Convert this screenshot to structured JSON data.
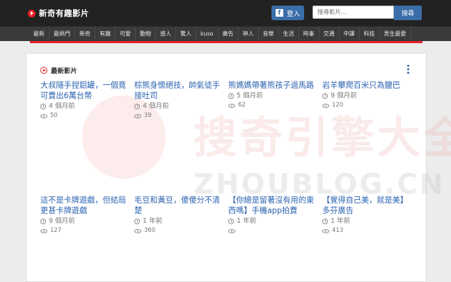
{
  "header": {
    "logo_text": "新奇有趣影片",
    "login_label": "登入",
    "fb_glyph": "f",
    "search_placeholder": "搜尋影片...",
    "search_label": "搜尋"
  },
  "nav": [
    "最新",
    "最熱門",
    "新奇",
    "有趣",
    "可愛",
    "動物",
    "感人",
    "驚人",
    "kuso",
    "廣告",
    "神人",
    "音樂",
    "生活",
    "時事",
    "交通",
    "中譯",
    "科技",
    "男生最愛"
  ],
  "section": {
    "title": "最新影片"
  },
  "videos": [
    {
      "title": "大叔隨手捏鋁罐，一個竟可賣出6萬台幣",
      "time": "4 個月前",
      "views": "50"
    },
    {
      "title": "棕熊身懷絕技，帥氣徒手接吐司",
      "time": "4 個月前",
      "views": "39"
    },
    {
      "title": "熊媽媽帶著熊孩子過馬路",
      "time": "5 個月前",
      "views": "62"
    },
    {
      "title": "岩羊攀爬百米只為鹽巴",
      "time": "9 個月前",
      "views": "120"
    },
    {
      "title": "這不是卡牌遊戲，但結局更甚卡牌遊戲",
      "time": "9 個月前",
      "views": "127"
    },
    {
      "title": "毛豆和黃豆，傻傻分不清楚",
      "time": "1 年前",
      "views": "360"
    },
    {
      "title": "【你總是留著沒有用的東西嗎】手機app拍賣",
      "time": "1 年前",
      "views": ""
    },
    {
      "title": "【覺得自己美，就是美】多芬廣告",
      "time": "1 年前",
      "views": "413"
    }
  ],
  "watermark": {
    "main": "搜奇引擎大全",
    "sub": "ZHOUBLOG.CN"
  },
  "colors": {
    "accent": "#e8202a",
    "link": "#2a62b0",
    "button": "#3a6ea8",
    "topbar": "#222222",
    "navbar": "#3a3a3a"
  }
}
